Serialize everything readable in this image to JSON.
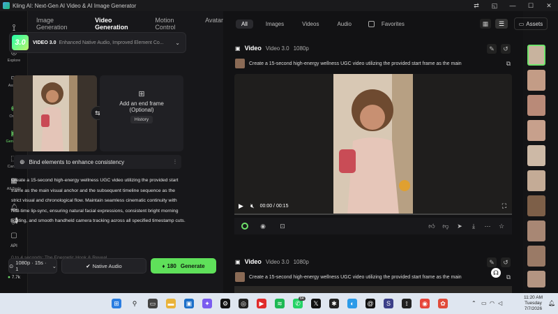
{
  "window": {
    "title": "Kling AI: Next-Gen AI Video & AI Image Generator",
    "controls": [
      "—",
      "☐",
      "✕"
    ]
  },
  "leftnav": [
    {
      "label": "Explore",
      "icon": "compass-icon"
    },
    {
      "label": "Assets",
      "icon": "folder-icon"
    },
    {
      "label": "Omni",
      "icon": "omni-icon"
    },
    {
      "label": "Generate",
      "icon": "generate-icon"
    },
    {
      "label": "Canvas",
      "icon": "canvas-icon"
    },
    {
      "label": "All Tools",
      "icon": "grid-icon"
    },
    {
      "label": "API",
      "icon": "api-icon"
    }
  ],
  "credits": "7.7k",
  "panel": {
    "tabs": [
      "Image Generation",
      "Video Generation",
      "Motion Control",
      "Avatar"
    ],
    "active_tab": "Video Generation",
    "model_name": "VIDEO 3.0",
    "model_desc": "Enhanced Native Audio, Improved Element Co...",
    "model_badge": "3.0",
    "end_frame_title": "Add an end frame",
    "end_frame_sub": "(Optional)",
    "history_label": "History",
    "bind_label": "Bind elements to enhance consistency",
    "prompt": "Create a 15-second high-energy wellness UGC video utilizing the provided start frame as the main visual anchor and the subsequent timeline sequence as the strict visual and chronological flow. Maintain seamless cinematic continuity with real-time lip-sync, ensuring natural facial expressions, consistent bright morning lighting, and smooth handheld camera tracking across all specified timestamp cuts.",
    "prompt_fade": "0 to 4 seconds: The Energetic Hook & Reveal",
    "options_label": "1080p · 15s · 1",
    "native_audio_label": "Native Audio",
    "generate_cost": "180",
    "generate_label": "Generate"
  },
  "filters": {
    "chips": [
      "All",
      "Images",
      "Videos",
      "Audio"
    ],
    "active": "All",
    "favorites": "Favorites",
    "assets": "Assets"
  },
  "cards": [
    {
      "type": "Video",
      "model": "Video 3.0",
      "res": "1080p",
      "prompt": "Create a 15-second high-energy wellness UGC video utilizing the provided start frame as the main",
      "time": "00:00 / 00:15"
    },
    {
      "type": "Video",
      "model": "Video 3.0",
      "res": "1080p",
      "prompt": "Create a 15-second high-energy wellness UGC video utilizing the provided start frame as the main"
    }
  ],
  "taskbar": {
    "time": "11:20 AM",
    "day": "Tuesday",
    "date": "7/7/2026",
    "badge": "64"
  }
}
